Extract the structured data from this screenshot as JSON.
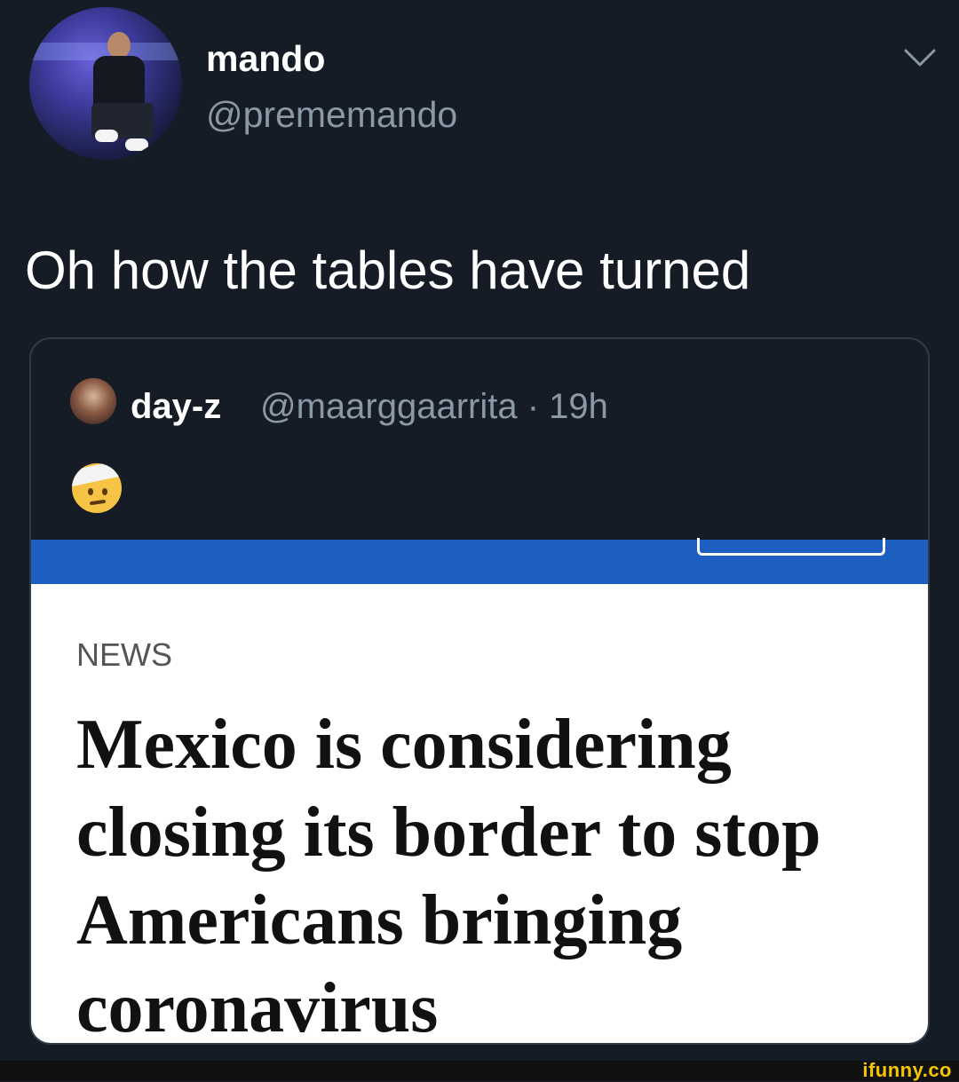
{
  "author": {
    "display_name": "mando",
    "handle": "@prememando"
  },
  "tweet": {
    "text": "Oh how the tables have turned"
  },
  "quoted_tweet": {
    "display_name": "day-z",
    "handle_time": "@maarggaarrita · 19h",
    "emoji_icon": "face-with-head-bandage-icon"
  },
  "article": {
    "section": "NEWS",
    "headline": "Mexico is considering closing its border to stop Americans bringing coronavirus"
  },
  "watermark": {
    "text": "ifunny.co"
  },
  "colors": {
    "background": "#151c26",
    "muted_text": "#8b98a5",
    "article_bar": "#1d5fc0",
    "watermark": "#f6c600"
  }
}
